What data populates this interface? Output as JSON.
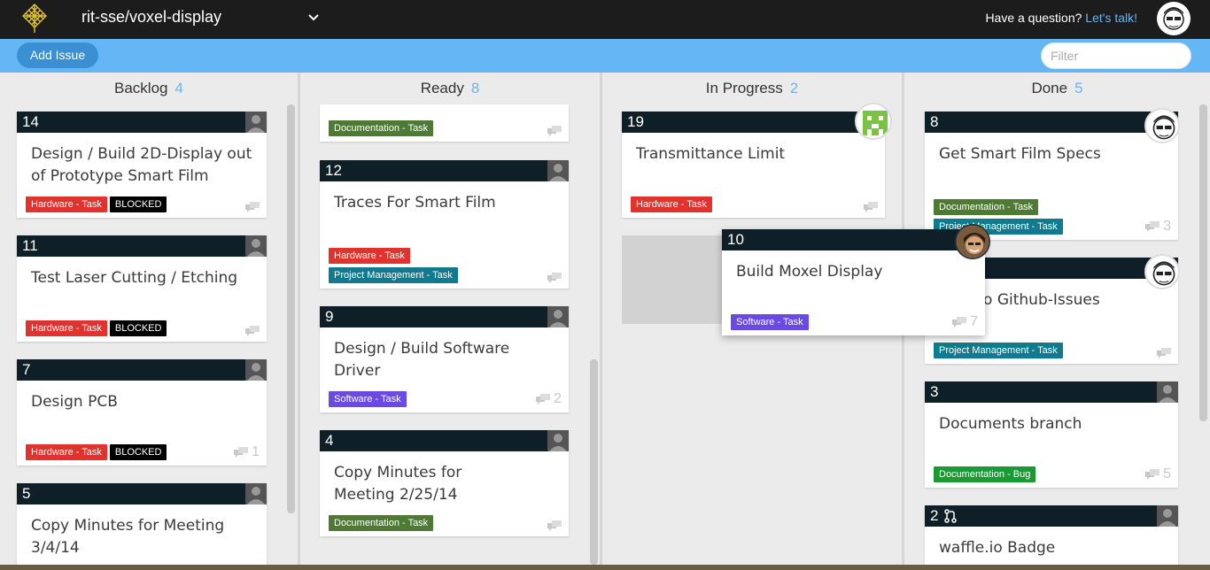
{
  "header": {
    "repo": "rit-sse/voxel-display",
    "question": "Have a question?",
    "link": "Let's talk!"
  },
  "toolbar": {
    "add_label": "Add Issue",
    "filter_placeholder": "Filter"
  },
  "columns": [
    {
      "name": "Backlog",
      "count": "4"
    },
    {
      "name": "Ready",
      "count": "8"
    },
    {
      "name": "In Progress",
      "count": "2"
    },
    {
      "name": "Done",
      "count": "5"
    }
  ],
  "cards": {
    "c14": {
      "num": "14",
      "title": "Design / Build 2D-Display out of Prototype Smart Film",
      "labels": [
        "Hardware - Task",
        "BLOCKED"
      ]
    },
    "c11": {
      "num": "11",
      "title": "Test Laser Cutting / Etching",
      "labels": [
        "Hardware - Task",
        "BLOCKED"
      ]
    },
    "c7": {
      "num": "7",
      "title": "Design PCB",
      "labels": [
        "Hardware - Task",
        "BLOCKED"
      ],
      "comments": "1"
    },
    "c5": {
      "num": "5",
      "title": "Copy Minutes for Meeting 3/4/14"
    },
    "ctop": {
      "labels": [
        "Documentation - Task"
      ]
    },
    "c12": {
      "num": "12",
      "title": "Traces For Smart Film",
      "labels": [
        "Hardware - Task",
        "Project Management - Task"
      ]
    },
    "c9": {
      "num": "9",
      "title": "Design / Build Software Driver",
      "labels": [
        "Software - Task"
      ],
      "comments": "2"
    },
    "c4": {
      "num": "4",
      "title": "Copy Minutes for Meeting 2/25/14",
      "labels": [
        "Documentation - Task"
      ]
    },
    "c19": {
      "num": "19",
      "title": "Transmittance Limit",
      "labels": [
        "Hardware - Task"
      ]
    },
    "c10": {
      "num": "10",
      "title": "Build Moxel Display",
      "labels": [
        "Software - Task"
      ],
      "comments": "7"
    },
    "c8": {
      "num": "8",
      "title": "Get Smart Film Specs",
      "labels": [
        "Documentation - Task",
        "Project Management - Task"
      ],
      "comments": "3"
    },
    "cx": {
      "title": "asks to Github-Issues",
      "labels": [
        "Project Management - Task"
      ]
    },
    "c3": {
      "num": "3",
      "title": "Documents branch",
      "labels": [
        "Documentation - Bug"
      ],
      "comments": "5"
    },
    "c2": {
      "num": "2",
      "title": "waffle.io Badge"
    }
  },
  "colors": {
    "hardware": "#e0332d",
    "documentation": "#4e7a35",
    "project_management": "#117a8e",
    "software": "#6a4ae3",
    "blocked": "#000000",
    "bug": "#1a9a34",
    "accent": "#65b6f4"
  },
  "icons": [
    "waffle-logo-icon",
    "chevron-down-icon",
    "comment-icon",
    "avatar-placeholder-icon",
    "pull-request-icon"
  ]
}
